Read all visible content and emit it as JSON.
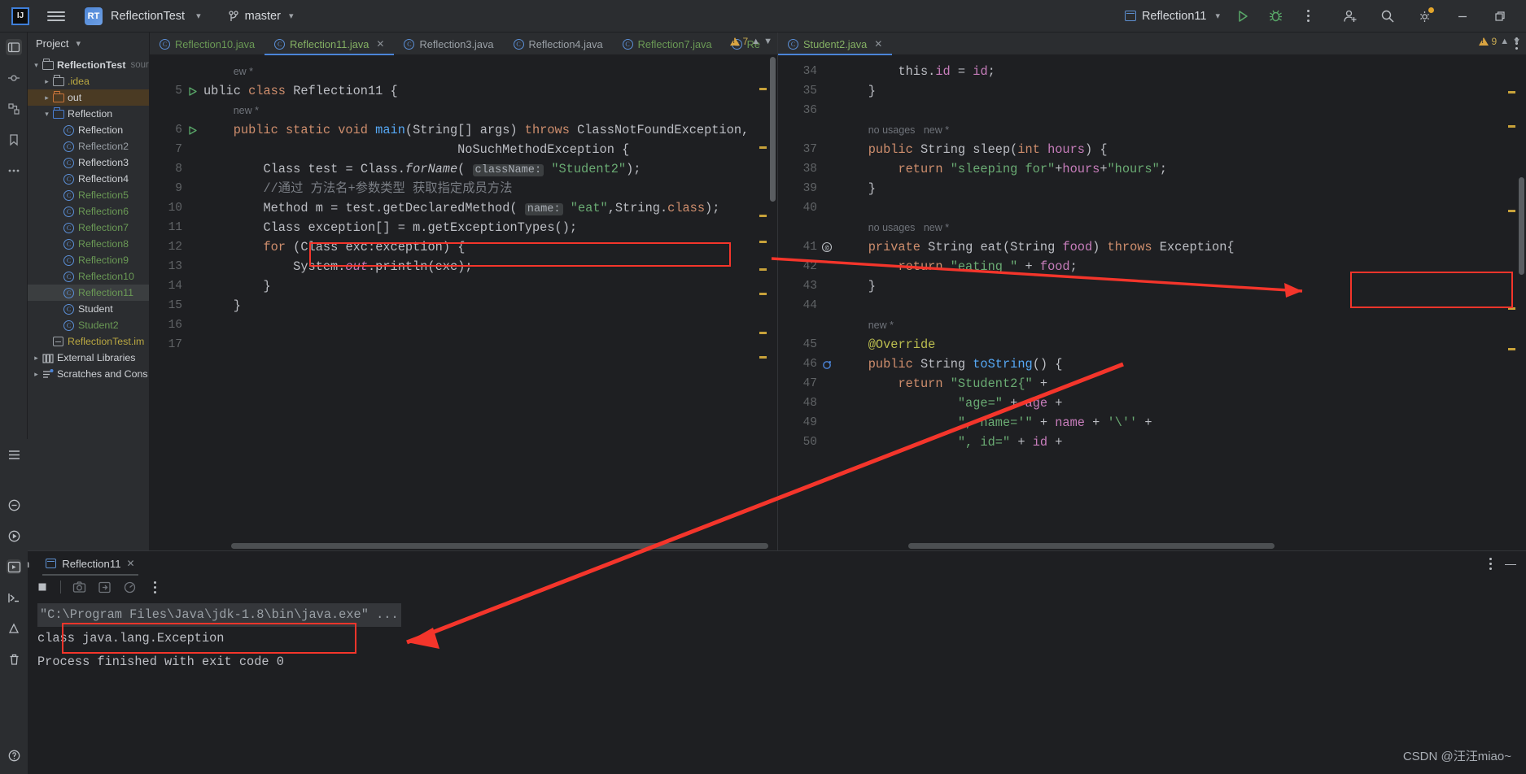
{
  "topbar": {
    "logo": "ij-logo",
    "project_badge": "RT",
    "project_name": "ReflectionTest",
    "branch": "master",
    "run_config": "Reflection11",
    "icons": [
      "menu-icon",
      "run-icon",
      "debug-icon",
      "more-icon",
      "add-user-icon",
      "search-icon",
      "settings-icon",
      "minimize-icon",
      "restore-icon"
    ]
  },
  "project_panel": {
    "title": "Project",
    "tree": [
      {
        "label": "ReflectionTest",
        "suffix": "sour",
        "indent": 0,
        "arrow": "v",
        "icon": "module-folder",
        "color": "#cfd2d6",
        "bold": true
      },
      {
        "label": ".idea",
        "indent": 1,
        "arrow": ">",
        "icon": "folder-gray",
        "color": "#b9a742"
      },
      {
        "label": "out",
        "indent": 1,
        "arrow": ">",
        "icon": "folder-orange",
        "color": "#cfd2d6",
        "highlight": true
      },
      {
        "label": "Reflection",
        "indent": 1,
        "arrow": "v",
        "icon": "folder-blue",
        "color": "#cfd2d6"
      },
      {
        "label": "Reflection",
        "indent": 2,
        "icon": "class",
        "color": "#cfd2d6"
      },
      {
        "label": "Reflection2",
        "indent": 2,
        "icon": "class",
        "color": "#9aa0a6"
      },
      {
        "label": "Reflection3",
        "indent": 2,
        "icon": "class",
        "color": "#cfd2d6"
      },
      {
        "label": "Reflection4",
        "indent": 2,
        "icon": "class",
        "color": "#cfd2d6"
      },
      {
        "label": "Reflection5",
        "indent": 2,
        "icon": "class",
        "color": "#6a9955"
      },
      {
        "label": "Reflection6",
        "indent": 2,
        "icon": "class",
        "color": "#6a9955"
      },
      {
        "label": "Reflection7",
        "indent": 2,
        "icon": "class",
        "color": "#6a9955"
      },
      {
        "label": "Reflection8",
        "indent": 2,
        "icon": "class",
        "color": "#6a9955"
      },
      {
        "label": "Reflection9",
        "indent": 2,
        "icon": "class",
        "color": "#6a9955"
      },
      {
        "label": "Reflection10",
        "indent": 2,
        "icon": "class",
        "color": "#6a9955"
      },
      {
        "label": "Reflection11",
        "indent": 2,
        "icon": "class",
        "color": "#6a9955",
        "selected": true
      },
      {
        "label": "Student",
        "indent": 2,
        "icon": "class",
        "color": "#cfd2d6"
      },
      {
        "label": "Student2",
        "indent": 2,
        "icon": "class",
        "color": "#6a9955"
      },
      {
        "label": "ReflectionTest.im",
        "indent": 1,
        "icon": "iml",
        "color": "#b9a742"
      },
      {
        "label": "External Libraries",
        "indent": 0,
        "arrow": ">",
        "icon": "library",
        "color": "#cfd2d6"
      },
      {
        "label": "Scratches and Cons",
        "indent": 0,
        "arrow": ">",
        "icon": "scratches",
        "color": "#cfd2d6"
      }
    ]
  },
  "editor_tabs": [
    {
      "label": "Reflection10.java",
      "state": "green"
    },
    {
      "label": "Reflection11.java",
      "state": "selected",
      "closable": true
    },
    {
      "label": "Reflection3.java",
      "state": "normal"
    },
    {
      "label": "Reflection4.java",
      "state": "normal"
    },
    {
      "label": "Reflection7.java",
      "state": "green"
    },
    {
      "label": "Re",
      "state": "green"
    }
  ],
  "right_tab": {
    "label": "Student2.java",
    "closable": true
  },
  "left_editor": {
    "inspection_count": "7",
    "partial_top": "ew *",
    "lines": [
      {
        "num": "5",
        "marker": "run",
        "content": "ublic class Reflection11 {"
      },
      {
        "num": "",
        "marker": "",
        "content": "    new *"
      },
      {
        "num": "6",
        "marker": "run",
        "content": "    public static void main(String[] args) throws ClassNotFoundException,"
      },
      {
        "num": "7",
        "marker": "",
        "content": "                                  NoSuchMethodException {"
      },
      {
        "num": "8",
        "marker": "",
        "content": "        Class test = Class.forName( className: \"Student2\");"
      },
      {
        "num": "9",
        "marker": "",
        "content": "        //通过 方法名+参数类型 获取指定成员方法"
      },
      {
        "num": "10",
        "marker": "",
        "content": "        Method m = test.getDeclaredMethod( name: \"eat\",String.class);"
      },
      {
        "num": "11",
        "marker": "",
        "content": "        Class exception[] = m.getExceptionTypes();"
      },
      {
        "num": "12",
        "marker": "",
        "content": "        for (Class exc:exception) {"
      },
      {
        "num": "13",
        "marker": "",
        "content": "            System.out.println(exc);"
      },
      {
        "num": "14",
        "marker": "",
        "content": "        }"
      },
      {
        "num": "15",
        "marker": "",
        "content": "    }"
      },
      {
        "num": "16",
        "marker": "",
        "content": ""
      },
      {
        "num": "17",
        "marker": "",
        "content": ""
      }
    ]
  },
  "right_editor": {
    "inspection_count": "9",
    "lines": [
      {
        "num": "34",
        "content": "        this.id = id;"
      },
      {
        "num": "35",
        "content": "    }"
      },
      {
        "num": "36",
        "content": ""
      },
      {
        "num": "",
        "content": "    no usages   new *"
      },
      {
        "num": "37",
        "content": "    public String sleep(int hours) {"
      },
      {
        "num": "38",
        "content": "        return \"sleeping for\"+hours+\"hours\";"
      },
      {
        "num": "39",
        "content": "    }"
      },
      {
        "num": "40",
        "content": ""
      },
      {
        "num": "",
        "content": "    no usages   new *"
      },
      {
        "num": "41",
        "marker": "at",
        "content": "    private String eat(String food) throws Exception{"
      },
      {
        "num": "42",
        "content": "        return \"eating \" + food;"
      },
      {
        "num": "43",
        "content": "    }"
      },
      {
        "num": "44",
        "content": ""
      },
      {
        "num": "",
        "content": "    new *"
      },
      {
        "num": "45",
        "content": "    @Override"
      },
      {
        "num": "46",
        "marker": "override",
        "content": "    public String toString() {"
      },
      {
        "num": "47",
        "content": "        return \"Student2{\" +"
      },
      {
        "num": "48",
        "content": "                \"age=\" + age +"
      },
      {
        "num": "49",
        "content": "                \", name='\" + name + '\\'' +"
      },
      {
        "num": "50",
        "content": "                \", id=\" + id +"
      }
    ]
  },
  "run_panel": {
    "title": "Run",
    "tab_label": "Reflection11",
    "toolbar_icons": [
      "rerun-icon",
      "stop-icon",
      "screenshot-icon",
      "export-icon",
      "coverage-icon",
      "more-icon"
    ],
    "side_icons": [
      "up-arrow-icon",
      "down-arrow-icon",
      "soft-wrap-icon",
      "scroll-to-end-icon",
      "print-icon"
    ],
    "output": [
      {
        "text": "\"C:\\Program Files\\Java\\jdk-1.8\\bin\\java.exe\" ...",
        "style": "command"
      },
      {
        "text": "class java.lang.Exception",
        "style": "normal",
        "boxed": true
      },
      {
        "text": "",
        "style": "normal"
      },
      {
        "text": "Process finished with exit code 0",
        "style": "normal"
      }
    ]
  },
  "annotations": {
    "box_code_line11": "Class exception[] = m.getExceptionTypes();",
    "box_throws": "throws Exception{",
    "box_console": "class java.lang.Exception",
    "arrow_color": "#f4352b"
  },
  "watermark": "CSDN @汪汪miao~",
  "colors": {
    "background": "#1e1f22",
    "panel": "#2b2d30",
    "accent_blue": "#4b84d8",
    "green": "#6a9955",
    "warning": "#d9a441",
    "annotation_red": "#f4352b"
  }
}
